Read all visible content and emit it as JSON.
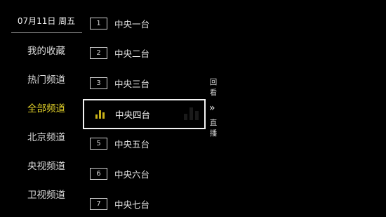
{
  "date": "07月11日 周五",
  "categories": [
    {
      "label": "我的收藏"
    },
    {
      "label": "热门频道"
    },
    {
      "label": "全部频道"
    },
    {
      "label": "北京频道"
    },
    {
      "label": "央视频道"
    },
    {
      "label": "卫视频道"
    }
  ],
  "active_category": "全部频道",
  "channels": [
    {
      "number": "1",
      "name": "中央一台"
    },
    {
      "number": "2",
      "name": "中央二台"
    },
    {
      "number": "3",
      "name": "中央三台"
    },
    {
      "number": "4",
      "name": "中央四台"
    },
    {
      "number": "5",
      "name": "中央五台"
    },
    {
      "number": "6",
      "name": "中央六台"
    },
    {
      "number": "7",
      "name": "中央七台"
    }
  ],
  "selected_channel": "中央四台",
  "side": {
    "replay_label": "回看",
    "live_label": "直播",
    "arrow": "»"
  },
  "colors": {
    "background": "#000000",
    "active": "#e6d52a",
    "playing_icon": "#c9b218",
    "selection_border": "#f2f2f2"
  },
  "icons": {
    "playing": "equalizer-bars-icon",
    "expand": "double-chevron-right-icon"
  }
}
